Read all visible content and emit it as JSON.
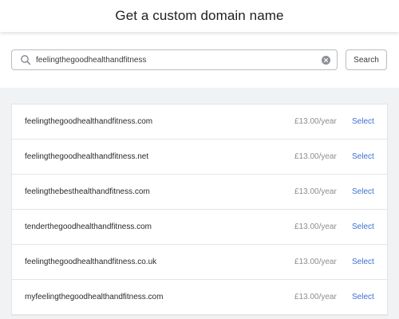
{
  "header": {
    "title": "Get a custom domain name"
  },
  "search": {
    "value": "feelingthegoodhealthandfitness",
    "button_label": "Search"
  },
  "results": [
    {
      "domain": "feelingthegoodhealthandfitness.com",
      "price": "£13.00/year",
      "action": "Select"
    },
    {
      "domain": "feelingthegoodhealthandfitness.net",
      "price": "£13.00/year",
      "action": "Select"
    },
    {
      "domain": "feelingthebesthealthandfitness.com",
      "price": "£13.00/year",
      "action": "Select"
    },
    {
      "domain": "tenderthegoodhealthandfitness.com",
      "price": "£13.00/year",
      "action": "Select"
    },
    {
      "domain": "feelingthegoodhealthandfitness.co.uk",
      "price": "£13.00/year",
      "action": "Select"
    },
    {
      "domain": "myfeelingthegoodhealthandfitness.com",
      "price": "£13.00/year",
      "action": "Select"
    }
  ],
  "icons": {
    "search": "search-icon",
    "clear": "clear-icon"
  },
  "colors": {
    "link": "#3c6fd0",
    "price": "#8a8d92",
    "background": "#f1f2f4"
  }
}
